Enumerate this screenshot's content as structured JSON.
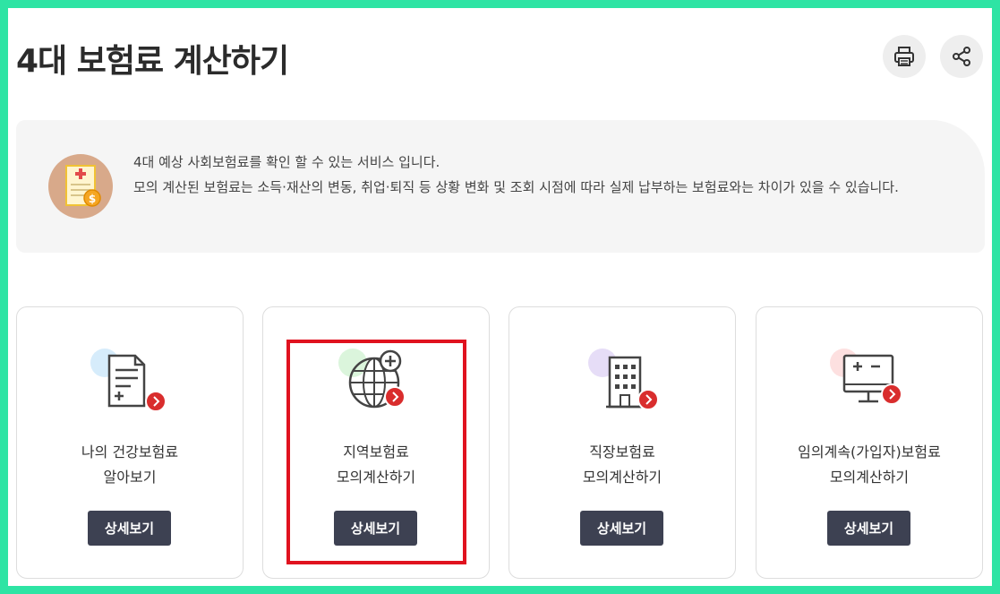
{
  "page": {
    "title": "4대 보험료 계산하기"
  },
  "toolbar": {
    "print_icon": "print-icon",
    "share_icon": "share-icon"
  },
  "info": {
    "line1": "4대 예상 사회보험료를 확인 할 수 있는 서비스 입니다.",
    "line2": "모의 계산된 보험료는 소득·재산의 변동, 취업·퇴직 등 상황 변화 및 조회 시점에 따라 실제 납부하는 보험료와는 차이가 있을 수 있습니다."
  },
  "cards": [
    {
      "title_line1": "나의 건강보험료",
      "title_line2": "알아보기",
      "button": "상세보기",
      "icon": "document-plus-icon",
      "accent": "#d6ecfb"
    },
    {
      "title_line1": "지역보험료",
      "title_line2": "모의계산하기",
      "button": "상세보기",
      "icon": "globe-plus-icon",
      "accent": "#dbf5dc"
    },
    {
      "title_line1": "직장보험료",
      "title_line2": "모의계산하기",
      "button": "상세보기",
      "icon": "building-icon",
      "accent": "#e6ddf7"
    },
    {
      "title_line1": "임의계속(가입자)보험료",
      "title_line2": "모의계산하기",
      "button": "상세보기",
      "icon": "monitor-calc-icon",
      "accent": "#fde0e0"
    }
  ],
  "colors": {
    "frame_border": "#2ee4a4",
    "button_bg": "#3d4152",
    "arrow_badge": "#d92d2d",
    "highlight": "#e0121f"
  }
}
